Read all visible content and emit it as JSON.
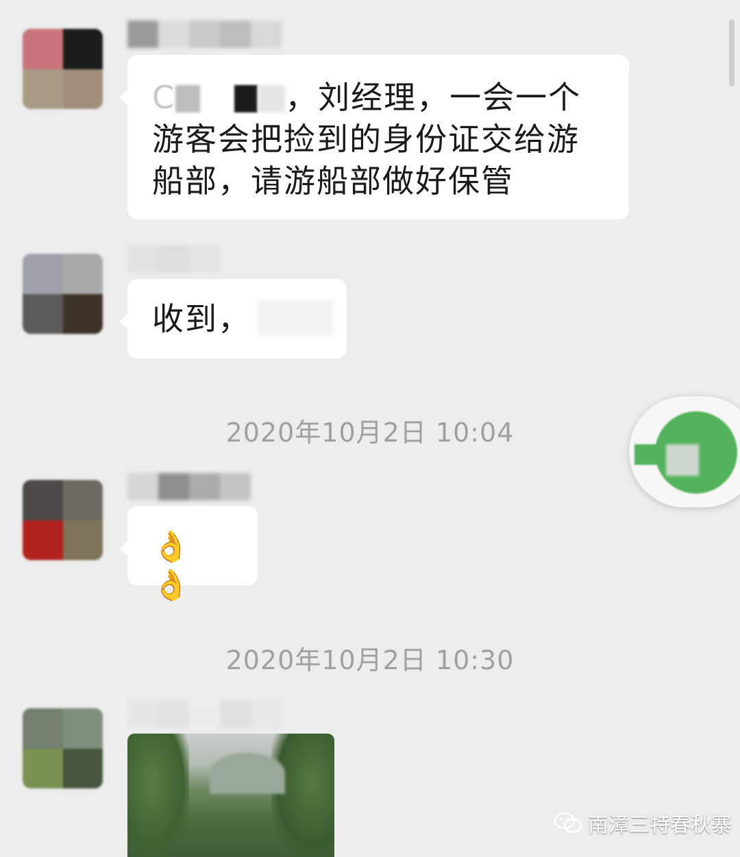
{
  "messages": [
    {
      "text_prefix": "C",
      "text_visible": "，刘经理，一会一个游客会把捡到的身份证交给游船部，请游船部做好保管"
    },
    {
      "text": "收到，"
    },
    {
      "emoji": "👌👌"
    }
  ],
  "timestamps": [
    "2020年10月2日 10:04",
    "2020年10月2日 10:30"
  ],
  "watermark": {
    "text": "南漳三特春秋寨",
    "icon": "wechat-icon"
  },
  "colors": {
    "background": "#ededed",
    "bubble": "#ffffff",
    "timestamp": "#a0a0a0",
    "float_green": "#52b35c"
  }
}
